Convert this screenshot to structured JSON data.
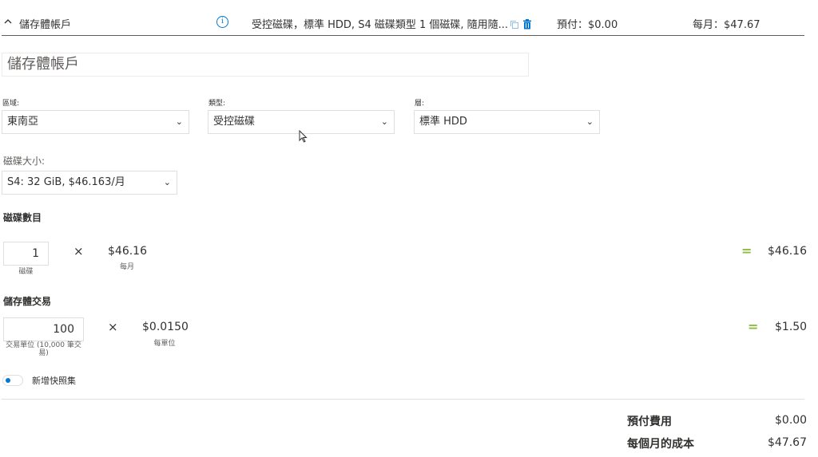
{
  "header": {
    "title": "儲存體帳戶",
    "description": "受控磁碟，標準 HDD, S4 磁碟類型 1 個磁碟, 隨用隨...",
    "upfront": "預付：$0.00",
    "monthly": "每月：$47.67"
  },
  "name_input": {
    "value": "儲存體帳戶"
  },
  "fields": {
    "region": {
      "label": "區域:",
      "value": "東南亞"
    },
    "type": {
      "label": "類型:",
      "value": "受控磁碟"
    },
    "tier": {
      "label": "層:",
      "value": "標準 HDD"
    },
    "disk_size": {
      "label": "磁碟大小:",
      "value": "S4: 32 GiB, $46.163/月"
    }
  },
  "disks": {
    "title": "磁碟數目",
    "quantity": "1",
    "quantity_unit": "磁碟",
    "times": "×",
    "unit_price": "$46.16",
    "unit_price_label": "每月",
    "equals": "=",
    "total": "$46.16"
  },
  "transactions": {
    "title": "儲存體交易",
    "quantity": "100",
    "quantity_unit": "交易單位 (10,000 筆交易)",
    "times": "×",
    "unit_price": "$0.0150",
    "unit_price_label": "每單位",
    "equals": "=",
    "total": "$1.50"
  },
  "snapshot_toggle": {
    "label": "新增快照集",
    "on": false
  },
  "summary": {
    "upfront_label": "預付費用",
    "upfront_value": "$0.00",
    "monthly_label": "每個月的成本",
    "monthly_value": "$47.67"
  },
  "colors": {
    "accent": "#0078d4",
    "equals_green": "#8cbd3f",
    "border": "#e1dfdd"
  }
}
